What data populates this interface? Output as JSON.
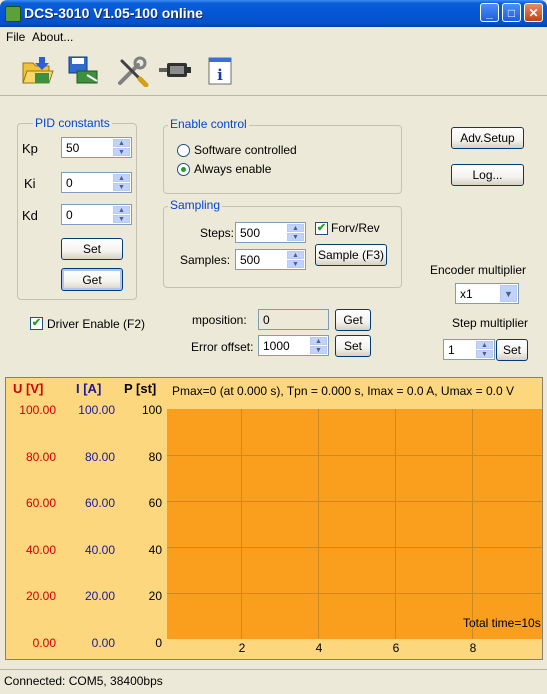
{
  "window": {
    "title": "DCS-3010 V1.05-100 online",
    "buttons": {
      "minimize": "_",
      "maximize": "□",
      "close": "✕"
    }
  },
  "menu": {
    "items": [
      "File",
      "About..."
    ]
  },
  "toolbar": {
    "icons": [
      "open-file-icon",
      "save-file-icon",
      "tools-icon",
      "connector-icon",
      "info-icon"
    ],
    "info_glyph": "i"
  },
  "pid": {
    "title": "PID constants",
    "kp_label": "Kp",
    "kp_value": "50",
    "ki_label": "Ki",
    "ki_value": "0",
    "kd_label": "Kd",
    "kd_value": "0",
    "set_label": "Set",
    "get_label": "Get"
  },
  "enable": {
    "title": "Enable control",
    "option_software": "Software controlled",
    "option_always": "Always enable",
    "selected": "Always enable"
  },
  "sampling": {
    "title": "Sampling",
    "steps_label": "Steps:",
    "steps_value": "500",
    "samples_label": "Samples:",
    "samples_value": "500",
    "forv_rev_label": "Forv/Rev",
    "forv_rev_checked": true,
    "sample_button": "Sample (F3)"
  },
  "right": {
    "adv_setup": "Adv.Setup",
    "log": "Log...",
    "encoder_label": "Encoder multiplier",
    "encoder_value": "x1",
    "step_label": "Step multiplier",
    "step_value": "1",
    "step_set": "Set"
  },
  "driver": {
    "label": "Driver Enable (F2)",
    "checked": true
  },
  "position": {
    "mposition_label": "mposition:",
    "mposition_value": "0",
    "mposition_get": "Get",
    "error_offset_label": "Error offset:",
    "error_offset_value": "1000",
    "error_offset_set": "Set"
  },
  "chart": {
    "u_head": "U [V]",
    "i_head": "I [A]",
    "p_head": "P [st]",
    "info": "Pmax=0 (at  0.000 s), Tpn = 0.000  s, Imax =  0.0 A, Umax = 0.0  V",
    "u_ticks": [
      "100.00",
      "80.00",
      "60.00",
      "40.00",
      "20.00",
      "0.00"
    ],
    "i_ticks": [
      "100.00",
      "80.00",
      "60.00",
      "40.00",
      "20.00",
      "0.00"
    ],
    "p_ticks": [
      "100",
      "80",
      "60",
      "40",
      "20",
      "0"
    ],
    "x_ticks": [
      "2",
      "4",
      "6",
      "8"
    ],
    "total_time": "Total time=10s",
    "colors": {
      "u": "#d20000",
      "i": "#1a1a9a",
      "p": "#000000",
      "plot_bg": "#f99f1d",
      "panel_bg": "#fcd77e"
    }
  },
  "status": {
    "text": "Connected: COM5, 38400bps"
  }
}
